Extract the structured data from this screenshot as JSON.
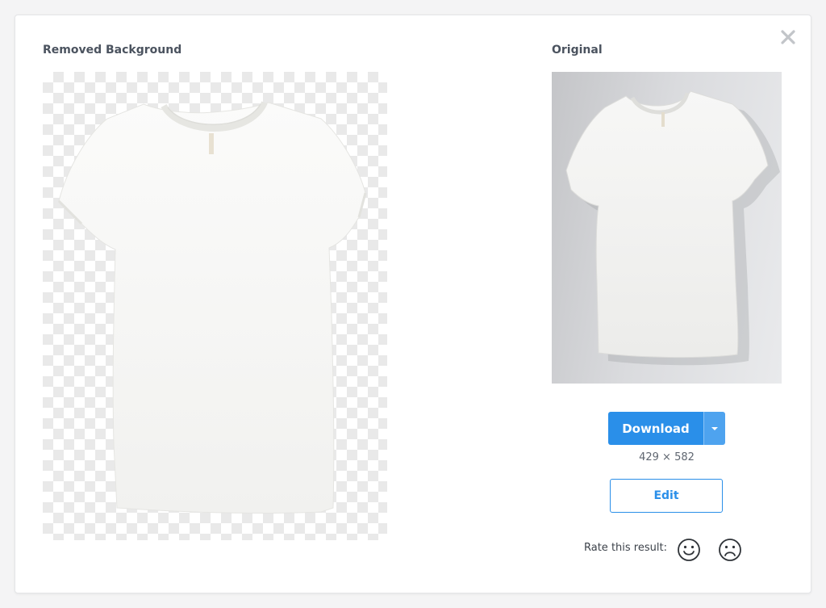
{
  "dialog": {
    "close_icon": "close-icon",
    "removed_heading": "Removed Background",
    "original_heading": "Original"
  },
  "download": {
    "label": "Download",
    "caret_icon": "chevron-down-icon",
    "dimensions": "429 × 582"
  },
  "edit": {
    "label": "Edit"
  },
  "rating": {
    "label": "Rate this result:",
    "positive_icon": "smiley-icon",
    "negative_icon": "frown-icon"
  },
  "colors": {
    "accent": "#2a8fe9",
    "heading": "#4b535f",
    "checker": "#e9e9e9"
  }
}
